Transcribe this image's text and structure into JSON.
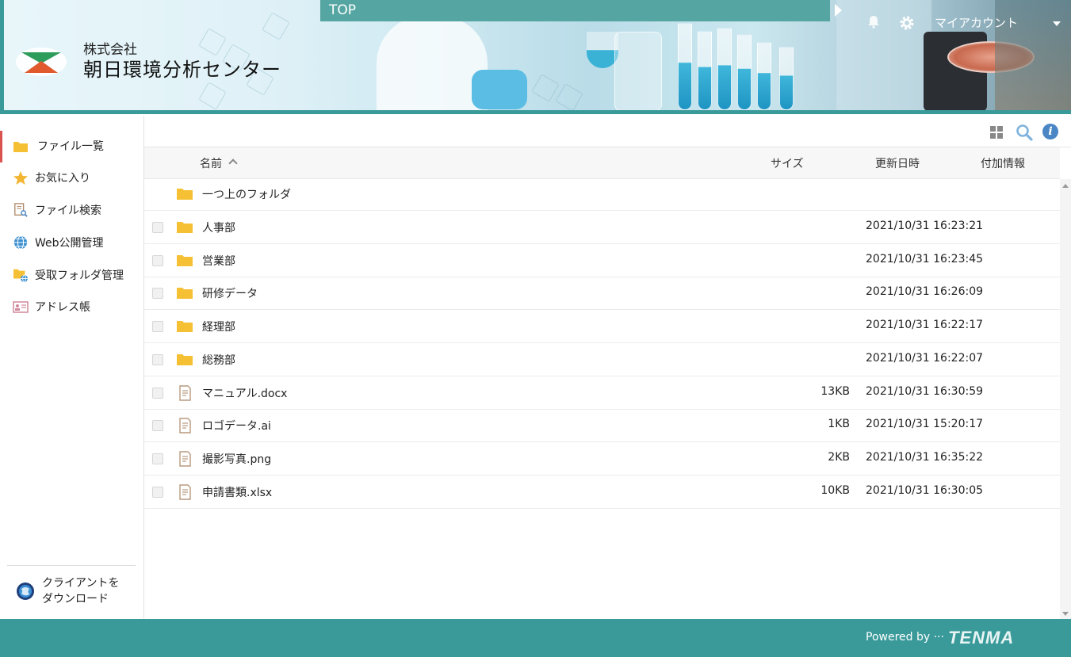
{
  "header": {
    "company_small": "株式会社",
    "company_large": "朝日環境分析センター",
    "breadcrumb": "TOP",
    "account_label": "マイアカウント"
  },
  "sidebar": {
    "items": [
      {
        "label": "ファイル一覧",
        "icon": "folder-icon"
      },
      {
        "label": "お気に入り",
        "icon": "star-icon"
      },
      {
        "label": "ファイル検索",
        "icon": "file-search-icon"
      },
      {
        "label": "Web公開管理",
        "icon": "globe-icon"
      },
      {
        "label": "受取フォルダ管理",
        "icon": "folder-globe-icon"
      },
      {
        "label": "アドレス帳",
        "icon": "address-card-icon"
      }
    ],
    "download_label": "クライアントを\nダウンロード"
  },
  "table": {
    "columns": {
      "name": "名前",
      "size": "サイズ",
      "updated": "更新日時",
      "info": "付加情報"
    },
    "parent_folder": "一つ上のフォルダ",
    "rows": [
      {
        "type": "folder",
        "name": "人事部",
        "size": "",
        "updated": "2021/10/31 16:23:21"
      },
      {
        "type": "folder",
        "name": "営業部",
        "size": "",
        "updated": "2021/10/31 16:23:45"
      },
      {
        "type": "folder",
        "name": "研修データ",
        "size": "",
        "updated": "2021/10/31 16:26:09"
      },
      {
        "type": "folder",
        "name": "経理部",
        "size": "",
        "updated": "2021/10/31 16:22:17"
      },
      {
        "type": "folder",
        "name": "総務部",
        "size": "",
        "updated": "2021/10/31 16:22:07"
      },
      {
        "type": "file",
        "name": "マニュアル.docx",
        "size": "13KB",
        "updated": "2021/10/31 16:30:59"
      },
      {
        "type": "file",
        "name": "ロゴデータ.ai",
        "size": "1KB",
        "updated": "2021/10/31 15:20:17"
      },
      {
        "type": "file",
        "name": "撮影写真.png",
        "size": "2KB",
        "updated": "2021/10/31 16:35:22"
      },
      {
        "type": "file",
        "name": "申請書類.xlsx",
        "size": "10KB",
        "updated": "2021/10/31 16:30:05"
      }
    ]
  },
  "footer": {
    "powered_by": "Powered by ···",
    "brand": "TENMA"
  },
  "colors": {
    "accent": "#3a9a9a",
    "topbar": "#55a6a2",
    "folder": "#f5c033",
    "active_marker": "#d9534f",
    "info_blue": "#4a86c5"
  }
}
